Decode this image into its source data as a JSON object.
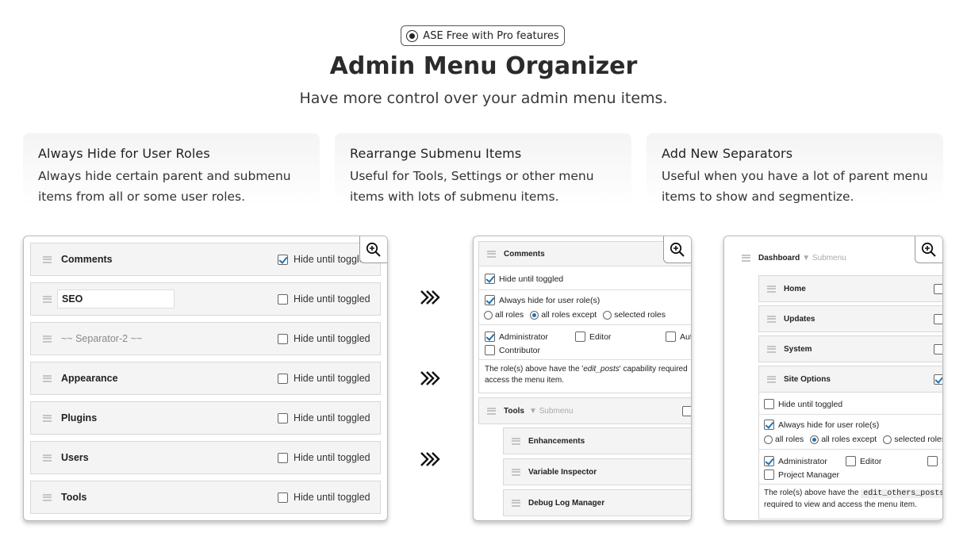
{
  "badge": {
    "text": "ASE Free with Pro features",
    "icon": "target-icon"
  },
  "title": "Admin Menu Organizer",
  "subtitle": "Have more control over your admin menu items.",
  "features": [
    {
      "title": "Always Hide for User Roles",
      "desc": "Always hide certain parent and submenu items from all or some user roles."
    },
    {
      "title": "Rearrange Submenu Items",
      "desc": "Useful for Tools, Settings or other menu items with lots of submenu items."
    },
    {
      "title": "Add New Separators",
      "desc": "Useful when you have a lot of parent menu items to show and segmentize."
    }
  ],
  "shot1": {
    "rows": [
      {
        "label": "Comments",
        "toggle": "Hide until toggled",
        "checked": true
      },
      {
        "label": "SEO",
        "toggle": "Hide until toggled",
        "checked": false
      },
      {
        "label": "~~ Separator-2 ~~",
        "toggle": "Hide until toggled",
        "checked": false
      },
      {
        "label": "Appearance",
        "toggle": "Hide until toggled",
        "checked": false
      },
      {
        "label": "Plugins",
        "toggle": "Hide until toggled",
        "checked": false
      },
      {
        "label": "Users",
        "toggle": "Hide until toggled",
        "checked": false
      },
      {
        "label": "Tools",
        "toggle": "Hide until toggled",
        "checked": false
      }
    ]
  },
  "shot2": {
    "header": "Comments",
    "hide_until": "Hide until toggled",
    "always_hide": "Always hide for user role(s)",
    "radio_all": "all roles",
    "radio_except": "all roles except",
    "radio_selected": "selected roles",
    "roles": [
      "Administrator",
      "Editor",
      "Aut",
      "Contributor"
    ],
    "note_line1_a": "The role(s) above have the '",
    "note_cap": "edit_posts",
    "note_line1_b": "' capability required",
    "note_line2": "access the menu item.",
    "tools_label": "Tools",
    "tools_sub": "▼ Submenu",
    "subitems": [
      "Enhancements",
      "Variable Inspector",
      "Debug Log Manager"
    ]
  },
  "shot3": {
    "header": "Dashboard",
    "header_sub": "▼ Submenu",
    "subitems": [
      "Home",
      "Updates",
      "System",
      "Site Options"
    ],
    "hide_until": "Hide until toggled",
    "always_hide": "Always hide for user role(s)",
    "radio_all": "all roles",
    "radio_except": "all roles except",
    "radio_selected": "selected roles",
    "roles": [
      "Administrator",
      "Editor",
      "S",
      "Project Manager"
    ],
    "note_a": "The role(s) above have the",
    "note_cap": "edit_others_posts",
    "note_line2": "required to view and access the menu item."
  },
  "colors": {
    "accent": "#2271b1",
    "row_bg": "#f4f4f4"
  }
}
